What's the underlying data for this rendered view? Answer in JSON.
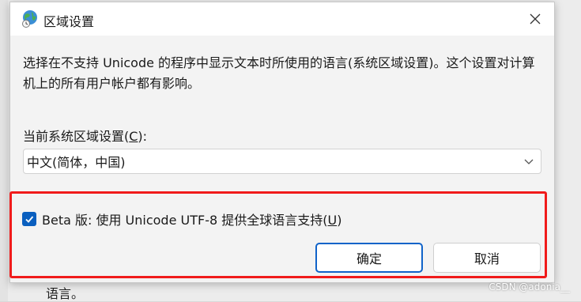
{
  "window": {
    "title": "区域设置",
    "icon": "globe-clock-icon",
    "close_icon": "close-icon"
  },
  "description": "选择在不支持 Unicode 的程序中显示文本时所使用的语言(系统区域设置)。这个设置对计算机上的所有用户帐户都有影响。",
  "locale": {
    "label_prefix": "当前系统区域设置(",
    "label_accel": "C",
    "label_suffix": "):",
    "selected": "中文(简体，中国)"
  },
  "beta": {
    "checked": true,
    "label_prefix": "Beta 版: 使用 Unicode UTF-8 提供全球语言支持(",
    "label_accel": "U",
    "label_suffix": ")"
  },
  "buttons": {
    "ok": "确定",
    "cancel": "取消"
  },
  "background_text": "语言。",
  "watermark": "CSDN @adonia__",
  "colors": {
    "accent": "#0a5fbf",
    "highlight_border": "#f01b1b"
  }
}
